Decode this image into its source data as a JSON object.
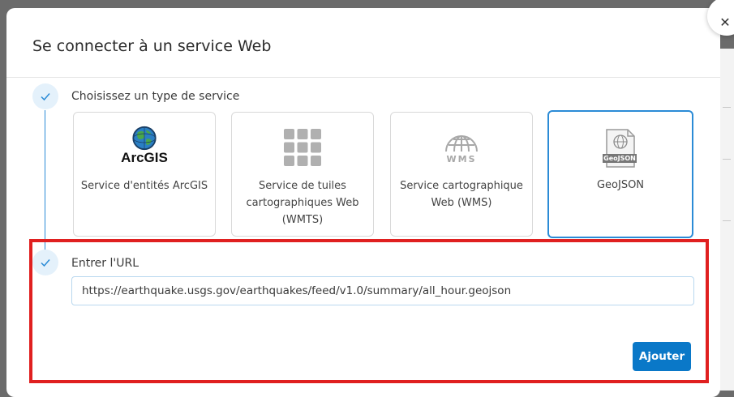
{
  "dialog": {
    "title": "Se connecter à un service Web",
    "close_symbol": "✕"
  },
  "step1": {
    "label": "Choisissez un type de service",
    "icon": "check-icon"
  },
  "cards": [
    {
      "logo_text": "ArcGIS",
      "label": "Service d'entités ArcGIS",
      "icon": "globe-icon",
      "selected": false
    },
    {
      "label": "Service de tuiles cartographiques Web (WMTS)",
      "icon": "tiles-grid-icon",
      "selected": false
    },
    {
      "logo_text": "WMS",
      "label": "Service cartographique Web (WMS)",
      "icon": "wms-globe-icon",
      "selected": false
    },
    {
      "logo_text": "GeoJSON",
      "label": "GeoJSON",
      "icon": "geojson-file-icon",
      "selected": true
    }
  ],
  "step2": {
    "label": "Entrer l'URL",
    "icon": "check-icon"
  },
  "url_input": {
    "value": "https://earthquake.usgs.gov/earthquakes/feed/v1.0/summary/all_hour.geojson"
  },
  "add_button": {
    "label": "Ajouter"
  },
  "colors": {
    "accent": "#2b8bd6",
    "button": "#0a78c8",
    "highlight": "#e02020"
  }
}
